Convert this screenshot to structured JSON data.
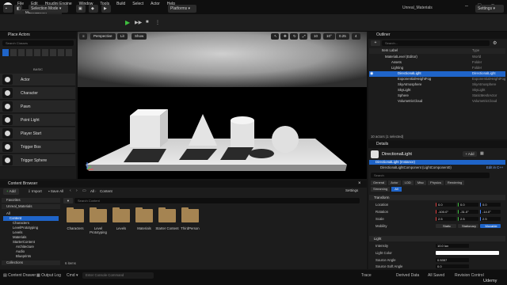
{
  "window": {
    "level_tab": "MaterialLevel",
    "project": "Unreal_Materials",
    "menu": [
      "File",
      "Edit",
      "Houdini Engine",
      "Window",
      "Tools",
      "Build",
      "Select",
      "Actor",
      "Help"
    ]
  },
  "toolbar": {
    "selection_mode": "Selection Mode",
    "platforms": "Platforms",
    "settings": "Settings"
  },
  "place_actors": {
    "title": "Place Actors",
    "search_placeholder": "Search Classes",
    "category": "BASIC",
    "items": [
      "Actor",
      "Character",
      "Pawn",
      "Point Light",
      "Player Start",
      "Trigger Box",
      "Trigger Sphere"
    ]
  },
  "viewport": {
    "perspective": "Perspective",
    "lit": "Lit",
    "show": "Show",
    "grid": "10",
    "rot": "10°",
    "scale": "0.25",
    "cam": "4"
  },
  "outliner": {
    "title": "Outliner",
    "search_placeholder": "Search...",
    "col_label": "Item Label",
    "col_type": "Type",
    "rows": [
      {
        "label": "MaterialLevel (Editor)",
        "type": "World"
      },
      {
        "label": "Assets",
        "type": "Folder"
      },
      {
        "label": "Lighting",
        "type": "Folder"
      },
      {
        "label": "DirectionalLight",
        "type": "DirectionalLight"
      },
      {
        "label": "ExponentialHeightFog",
        "type": "ExponentialHeightFog"
      },
      {
        "label": "SkyAtmosphere",
        "type": "SkyAtmosphere"
      },
      {
        "label": "SkyLight",
        "type": "SkyLight"
      },
      {
        "label": "Sphere",
        "type": "StaticMeshActor"
      },
      {
        "label": "VolumetricCloud",
        "type": "VolumetricCloud"
      }
    ],
    "count": "10 actors (1 selected)"
  },
  "details": {
    "title": "Details",
    "actor": "DirectionalLight",
    "add": "+ Add",
    "instance": "DirectionalLight (Instance)",
    "component": "DirectionalLightComponent (LightComponent0)",
    "edit_cpp": "Edit in C++",
    "search_placeholder": "Search",
    "tabs_row1": [
      "General",
      "Actor",
      "LOD",
      "Misc",
      "Physics",
      "Rendering"
    ],
    "tabs_row2": [
      "Streaming",
      "All"
    ],
    "transform": "Transform",
    "location_label": "Location",
    "location": [
      "0.0",
      "0.0",
      "0.0"
    ],
    "rotation_label": "Rotation",
    "rotation": [
      "-100.0°",
      "-31.0°",
      "-14.0°"
    ],
    "scale_label": "Scale",
    "scale": [
      "2.5",
      "2.5",
      "2.5"
    ],
    "mobility_label": "Mobility",
    "mobility": [
      "Static",
      "Stationary",
      "Movable"
    ],
    "light": "Light",
    "intensity_label": "Intensity",
    "intensity": "10.0 lux",
    "light_color_label": "Light Color",
    "source_angle_label": "Source Angle",
    "source_angle": "0.5357",
    "source_soft_angle_label": "Source Soft Angle",
    "source_soft_angle": "0.0"
  },
  "content_browser": {
    "title": "Content Browser",
    "add": "Add",
    "import": "Import",
    "save_all": "Save All",
    "path": [
      "All",
      "Content"
    ],
    "settings": "Settings",
    "favorites": "Favorites",
    "project": "Unreal_Materials",
    "tree": [
      "All",
      "Content",
      "Characters",
      "LevelPrototyping",
      "Levels",
      "Materials",
      "StarterContent",
      "Architecture",
      "Audio",
      "Blueprints"
    ],
    "search_placeholder": "Search Content",
    "folders": [
      "Characters",
      "Level Prototyping",
      "Levels",
      "Materials",
      "Starter Content",
      "ThirdPerson"
    ],
    "items_count": "6 items",
    "collections": "Collections"
  },
  "statusbar": {
    "content_drawer": "Content Drawer",
    "output_log": "Output Log",
    "cmd": "Cmd",
    "console_placeholder": "Enter Console Command",
    "trace": "Trace",
    "derived_data": "Derived Data",
    "all_saved": "All Saved",
    "revision_control": "Revision Control",
    "watermark": "Udemy"
  },
  "colors": {
    "accent": "#1f64c8",
    "play": "#3fbf3f",
    "folder": "#a58452"
  }
}
